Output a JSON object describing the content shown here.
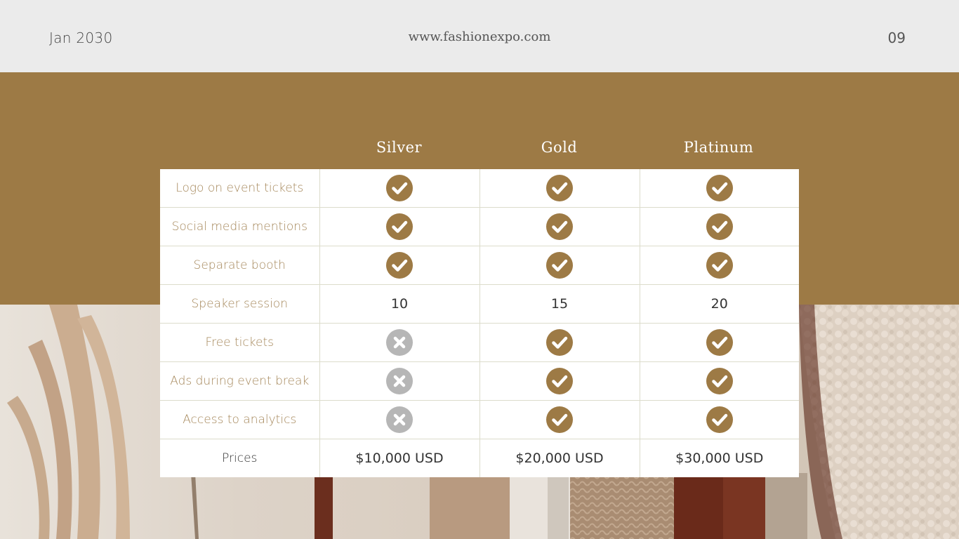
{
  "header": {
    "date": "Jan  2030",
    "url": "www.fashionexpo.com",
    "page_number": "09"
  },
  "colors": {
    "brand": "#9d7a45",
    "check_fill": "#9d7a45",
    "cross_fill": "#b6b6b6",
    "feature_text": "#a5875a"
  },
  "tiers": [
    "Silver",
    "Gold",
    "Platinum"
  ],
  "rows": [
    {
      "feature": "Logo on event tickets",
      "cells": [
        "check-icon",
        "check-icon",
        "check-icon"
      ]
    },
    {
      "feature": "Social media mentions",
      "cells": [
        "check-icon",
        "check-icon",
        "check-icon"
      ]
    },
    {
      "feature": "Separate booth",
      "cells": [
        "check-icon",
        "check-icon",
        "check-icon"
      ]
    },
    {
      "feature": "Speaker session",
      "cells": [
        "10",
        "15",
        "20"
      ]
    },
    {
      "feature": "Free tickets",
      "cells": [
        "cross-icon",
        "check-icon",
        "check-icon"
      ]
    },
    {
      "feature": "Ads during event break",
      "cells": [
        "cross-icon",
        "check-icon",
        "check-icon"
      ]
    },
    {
      "feature": "Access to analytics",
      "cells": [
        "cross-icon",
        "check-icon",
        "check-icon"
      ]
    },
    {
      "feature": "Prices",
      "cells": [
        "$10,000 USD",
        "$20,000 USD",
        "$30,000 USD"
      ]
    }
  ]
}
